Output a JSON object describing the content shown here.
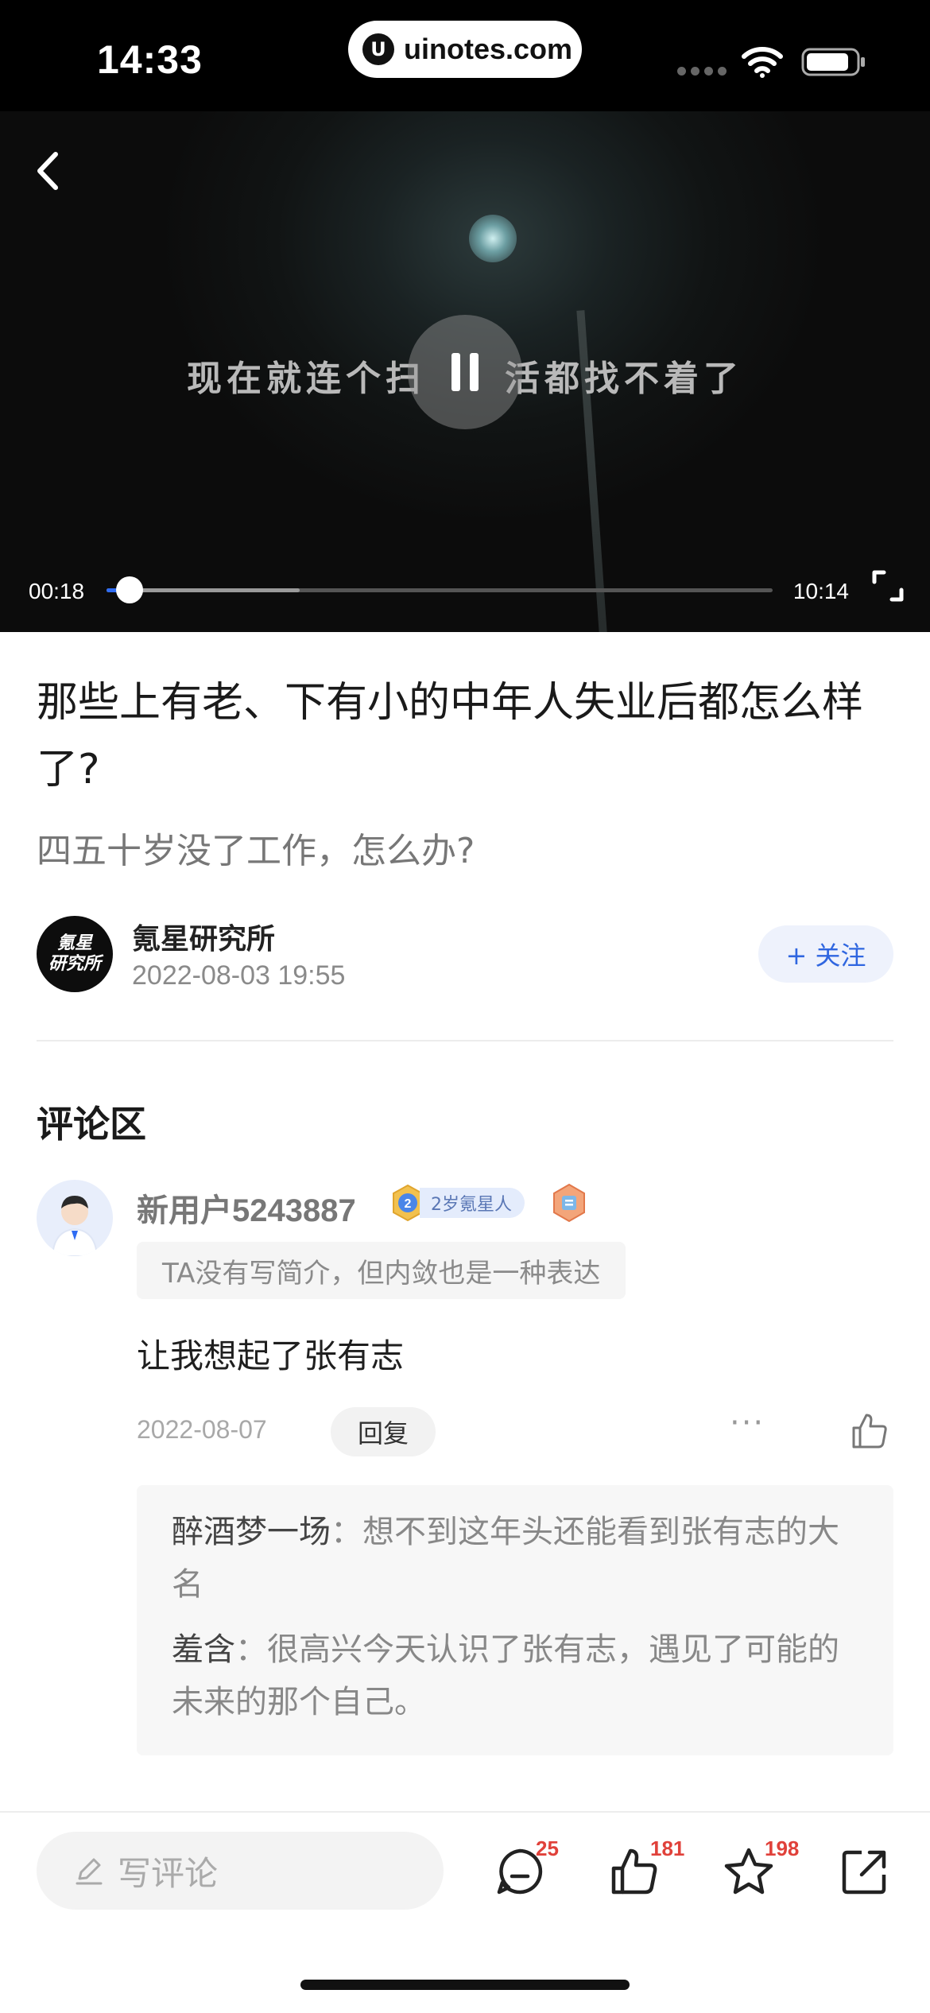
{
  "status_bar": {
    "time": "14:33",
    "url": "uinotes.com",
    "url_logo": "U"
  },
  "video": {
    "subtitle": "现在就连个扫　　活都找不着了",
    "current_time": "00:18",
    "total_time": "10:14",
    "played_fraction": 0.035,
    "buffered_fraction": 0.29,
    "state": "playing"
  },
  "article": {
    "title": "那些上有老、下有小的中年人失业后都怎么样了?",
    "summary": "四五十岁没了工作，怎么办?",
    "author": {
      "avatar_line1": "氪星",
      "avatar_line2": "研究所",
      "name": "氪星研究所",
      "date": "2022-08-03 19:55"
    },
    "follow_label": "+ 关注"
  },
  "comments": {
    "heading": "评论区",
    "items": [
      {
        "user": "新用户5243887",
        "badge": "2岁氪星人",
        "bio": "TA没有写简介，但内敛也是一种表达",
        "text": "让我想起了张有志",
        "date": "2022-08-07",
        "reply_label": "回复",
        "more": "···",
        "replies": [
          {
            "user": "醉酒梦一场",
            "sep": "：",
            "text": "想不到这年头还能看到张有志的大名"
          },
          {
            "user": "羞含",
            "sep": "：",
            "text": "很高兴今天认识了张有志，遇见了可能的未来的那个自己。"
          }
        ]
      }
    ]
  },
  "bottom_bar": {
    "input_placeholder": "写评论",
    "comment_count": "25",
    "like_count": "181",
    "favorite_count": "198"
  },
  "colors": {
    "accent": "#2f6cf3",
    "badge_red": "#e0413a",
    "follow_bg": "#eef2fc"
  },
  "icons": [
    "back-icon",
    "pause-icon",
    "fullscreen-icon",
    "wifi-icon",
    "battery-icon",
    "like-icon",
    "more-icon",
    "pen-icon",
    "comment-icon",
    "thumb-icon",
    "star-icon",
    "share-icon"
  ]
}
